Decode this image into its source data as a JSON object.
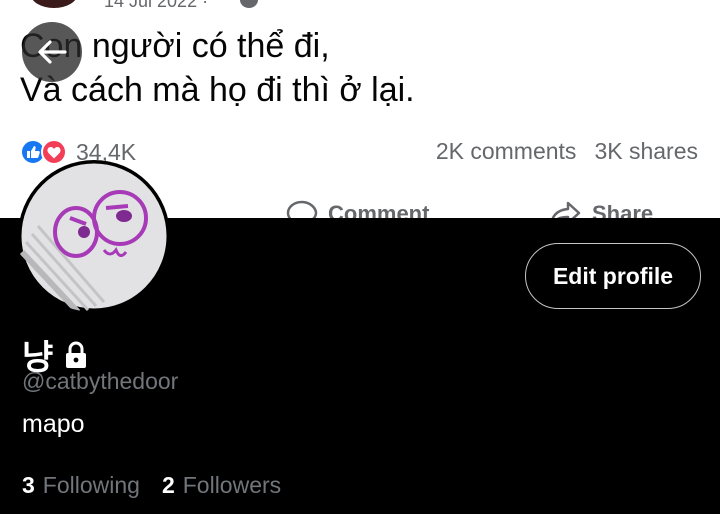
{
  "post": {
    "date": "14 Jul 2022 ·",
    "text_line1": "Con người có thể đi,",
    "text_line2": "Và cách mà họ đi thì ở lại.",
    "reaction_count": "34,4K",
    "comments": "2K comments",
    "shares": "3K shares",
    "comment_label": "Comment",
    "share_label": "Share",
    "icons": [
      "globe-icon",
      "like-icon",
      "love-icon",
      "comment-icon",
      "share-icon"
    ]
  },
  "profile": {
    "display_name": "냥",
    "handle": "@catbythedoor",
    "bio": "mapo",
    "edit_profile_label": "Edit profile",
    "following_count": "3",
    "following_label": "Following",
    "followers_count": "2",
    "followers_label": "Followers",
    "icons": [
      "back-arrow-icon",
      "lock-icon"
    ]
  },
  "colors": {
    "background": "#000000",
    "secondary_text": "#71767b",
    "facebook_blue": "#1877f2",
    "love_red": "#f33e58"
  }
}
